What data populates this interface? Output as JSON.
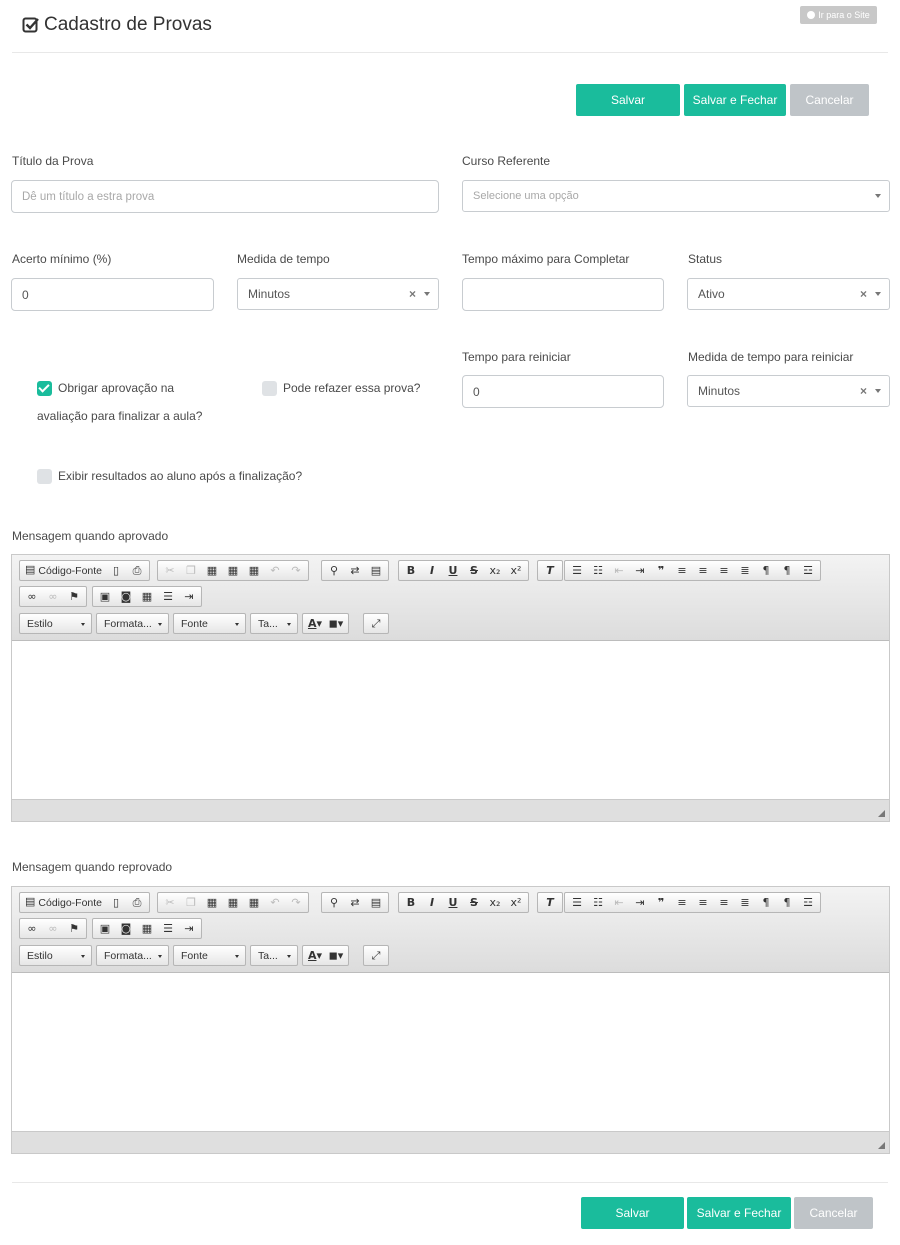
{
  "header": {
    "title": "Cadastro de Provas",
    "site_link": "Ir para o Site"
  },
  "actions": {
    "save": "Salvar",
    "save_close": "Salvar e Fechar",
    "cancel": "Cancelar"
  },
  "form": {
    "titulo": {
      "label": "Título da Prova",
      "placeholder": "Dê um título a estra prova"
    },
    "curso": {
      "label": "Curso Referente",
      "placeholder": "Selecione uma opção"
    },
    "acerto": {
      "label": "Acerto mínimo (%)",
      "value": "0"
    },
    "medida": {
      "label": "Medida de tempo",
      "value": "Minutos"
    },
    "tempo_max": {
      "label": "Tempo máximo para Completar",
      "value": ""
    },
    "status": {
      "label": "Status",
      "value": "Ativo"
    },
    "tempo_reiniciar": {
      "label": "Tempo para reiniciar",
      "value": "0"
    },
    "medida_reiniciar": {
      "label": "Medida de tempo para reiniciar",
      "value": "Minutos"
    },
    "obrigar": {
      "label_line1": "Obrigar aprovação na",
      "label_line2": "avaliação para finalizar a aula?",
      "checked": true
    },
    "refazer": {
      "label": "Pode refazer essa prova?",
      "checked": false
    },
    "exibir": {
      "label": "Exibir resultados ao aluno após a finalização?",
      "checked": false
    }
  },
  "editors": [
    {
      "label": "Mensagem quando aprovado"
    },
    {
      "label": "Mensagem quando reprovado"
    }
  ],
  "toolbar": {
    "source": "Código-Fonte",
    "style": "Estilo",
    "format": "Formata...",
    "font": "Fonte",
    "size": "Ta...",
    "clear_symbol": "×",
    "colors": {
      "accent": "#1abc9c",
      "cancel": "#bfc4c8"
    }
  }
}
